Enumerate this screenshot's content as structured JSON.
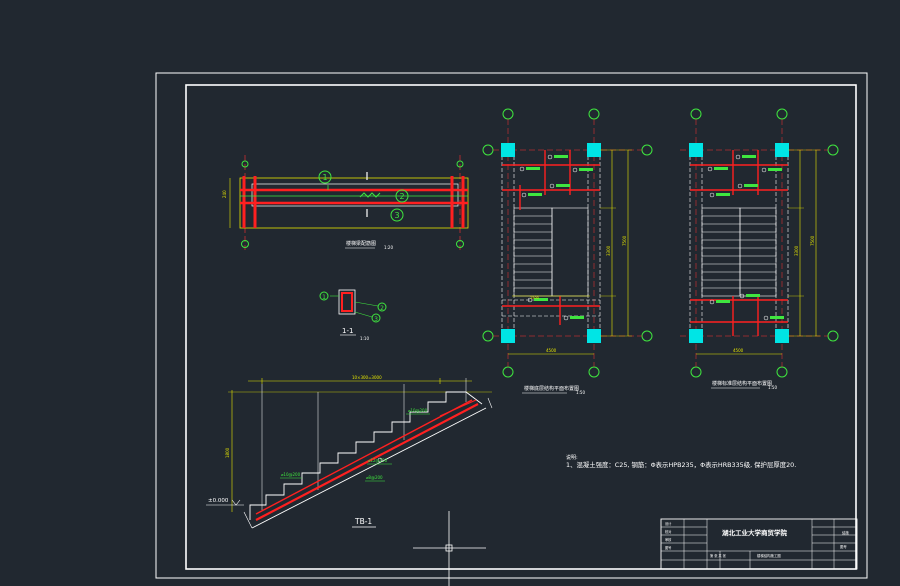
{
  "beam_section": {
    "title": "楼梯梁配筋图",
    "scale": "1:20",
    "dim_left": "240",
    "markers": [
      "1",
      "2",
      "3"
    ]
  },
  "small_section": {
    "label": "1-1",
    "scale": "1:10",
    "markers": [
      "1",
      "2",
      "3"
    ]
  },
  "plan_left": {
    "title": "楼梯底层结构平面布置图",
    "scale": "1:50",
    "dim_bottom": "4500",
    "dim_right": "7500",
    "dim_right_mid": "3300",
    "dim_bottom_mid": "1500"
  },
  "plan_right": {
    "title": "楼梯标准层结构平面布置图",
    "scale": "1:50",
    "dim_bottom": "4500",
    "dim_right": "7500",
    "dim_right_mid": "3300"
  },
  "stair": {
    "label": "TB-1",
    "level": "±0.000",
    "dim_top": "10×300=3000",
    "dim_left": "1800",
    "rebar_1": "⌀10@200",
    "rebar_2": "⌀12@150",
    "rebar_3": "⌀8@200"
  },
  "notes": {
    "heading": "说明:",
    "line1": "1、混凝土强度：C25, 钢筋：Φ表示HPB235，Φ表示HRB335级, 保护层厚度20."
  },
  "title_block": {
    "school": "湖北工业大学商贸学院",
    "drawing_name": "楼梯结构施工图",
    "row1": "设计",
    "row2": "校对",
    "row3": "审核",
    "row4": "图号",
    "right_top": "结施",
    "right_mid": "图号",
    "sheet": "第 张 共 张"
  },
  "colors": {
    "background": "#212830",
    "frame": "#ffffff",
    "rebar": "#ff2020",
    "annotation": "#3fe63f",
    "dimension": "#e6e600",
    "column": "#00e5e5"
  }
}
